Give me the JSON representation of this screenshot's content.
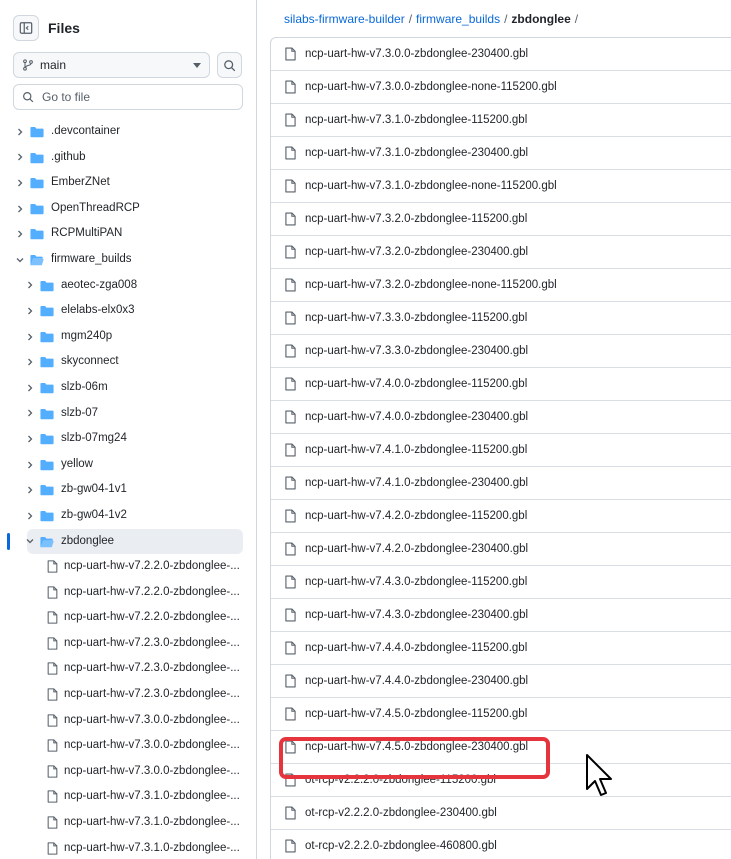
{
  "sidebar": {
    "title": "Files",
    "branch": "main",
    "goto_placeholder": "Go to file",
    "tree": [
      {
        "label": ".devcontainer",
        "type": "folder",
        "depth": 0,
        "expanded": false
      },
      {
        "label": ".github",
        "type": "folder",
        "depth": 0,
        "expanded": false
      },
      {
        "label": "EmberZNet",
        "type": "folder",
        "depth": 0,
        "expanded": false
      },
      {
        "label": "OpenThreadRCP",
        "type": "folder",
        "depth": 0,
        "expanded": false
      },
      {
        "label": "RCPMultiPAN",
        "type": "folder",
        "depth": 0,
        "expanded": false
      },
      {
        "label": "firmware_builds",
        "type": "folder",
        "depth": 0,
        "expanded": true
      },
      {
        "label": "aeotec-zga008",
        "type": "folder",
        "depth": 1,
        "expanded": false
      },
      {
        "label": "elelabs-elx0x3",
        "type": "folder",
        "depth": 1,
        "expanded": false
      },
      {
        "label": "mgm240p",
        "type": "folder",
        "depth": 1,
        "expanded": false
      },
      {
        "label": "skyconnect",
        "type": "folder",
        "depth": 1,
        "expanded": false
      },
      {
        "label": "slzb-06m",
        "type": "folder",
        "depth": 1,
        "expanded": false
      },
      {
        "label": "slzb-07",
        "type": "folder",
        "depth": 1,
        "expanded": false
      },
      {
        "label": "slzb-07mg24",
        "type": "folder",
        "depth": 1,
        "expanded": false
      },
      {
        "label": "yellow",
        "type": "folder",
        "depth": 1,
        "expanded": false
      },
      {
        "label": "zb-gw04-1v1",
        "type": "folder",
        "depth": 1,
        "expanded": false
      },
      {
        "label": "zb-gw04-1v2",
        "type": "folder",
        "depth": 1,
        "expanded": false
      },
      {
        "label": "zbdonglee",
        "type": "folder",
        "depth": 1,
        "expanded": true,
        "selected": true
      },
      {
        "label": "ncp-uart-hw-v7.2.2.0-zbdonglee-...",
        "type": "file",
        "depth": 2
      },
      {
        "label": "ncp-uart-hw-v7.2.2.0-zbdonglee-...",
        "type": "file",
        "depth": 2
      },
      {
        "label": "ncp-uart-hw-v7.2.2.0-zbdonglee-...",
        "type": "file",
        "depth": 2
      },
      {
        "label": "ncp-uart-hw-v7.2.3.0-zbdonglee-...",
        "type": "file",
        "depth": 2
      },
      {
        "label": "ncp-uart-hw-v7.2.3.0-zbdonglee-...",
        "type": "file",
        "depth": 2
      },
      {
        "label": "ncp-uart-hw-v7.2.3.0-zbdonglee-...",
        "type": "file",
        "depth": 2
      },
      {
        "label": "ncp-uart-hw-v7.3.0.0-zbdonglee-...",
        "type": "file",
        "depth": 2
      },
      {
        "label": "ncp-uart-hw-v7.3.0.0-zbdonglee-...",
        "type": "file",
        "depth": 2
      },
      {
        "label": "ncp-uart-hw-v7.3.0.0-zbdonglee-...",
        "type": "file",
        "depth": 2
      },
      {
        "label": "ncp-uart-hw-v7.3.1.0-zbdonglee-...",
        "type": "file",
        "depth": 2
      },
      {
        "label": "ncp-uart-hw-v7.3.1.0-zbdonglee-...",
        "type": "file",
        "depth": 2
      },
      {
        "label": "ncp-uart-hw-v7.3.1.0-zbdonglee-...",
        "type": "file",
        "depth": 2
      }
    ]
  },
  "breadcrumb": {
    "repo": "silabs-firmware-builder",
    "sep": "/",
    "folder": "firmware_builds",
    "current": "zbdonglee"
  },
  "files": [
    "ncp-uart-hw-v7.3.0.0-zbdonglee-230400.gbl",
    "ncp-uart-hw-v7.3.0.0-zbdonglee-none-115200.gbl",
    "ncp-uart-hw-v7.3.1.0-zbdonglee-115200.gbl",
    "ncp-uart-hw-v7.3.1.0-zbdonglee-230400.gbl",
    "ncp-uart-hw-v7.3.1.0-zbdonglee-none-115200.gbl",
    "ncp-uart-hw-v7.3.2.0-zbdonglee-115200.gbl",
    "ncp-uart-hw-v7.3.2.0-zbdonglee-230400.gbl",
    "ncp-uart-hw-v7.3.2.0-zbdonglee-none-115200.gbl",
    "ncp-uart-hw-v7.3.3.0-zbdonglee-115200.gbl",
    "ncp-uart-hw-v7.3.3.0-zbdonglee-230400.gbl",
    "ncp-uart-hw-v7.4.0.0-zbdonglee-115200.gbl",
    "ncp-uart-hw-v7.4.0.0-zbdonglee-230400.gbl",
    "ncp-uart-hw-v7.4.1.0-zbdonglee-115200.gbl",
    "ncp-uart-hw-v7.4.1.0-zbdonglee-230400.gbl",
    "ncp-uart-hw-v7.4.2.0-zbdonglee-115200.gbl",
    "ncp-uart-hw-v7.4.2.0-zbdonglee-230400.gbl",
    "ncp-uart-hw-v7.4.3.0-zbdonglee-115200.gbl",
    "ncp-uart-hw-v7.4.3.0-zbdonglee-230400.gbl",
    "ncp-uart-hw-v7.4.4.0-zbdonglee-115200.gbl",
    "ncp-uart-hw-v7.4.4.0-zbdonglee-230400.gbl",
    "ncp-uart-hw-v7.4.5.0-zbdonglee-115200.gbl",
    "ncp-uart-hw-v7.4.5.0-zbdonglee-230400.gbl",
    "ot-rcp-v2.2.2.0-zbdonglee-115200.gbl",
    "ot-rcp-v2.2.2.0-zbdonglee-230400.gbl",
    "ot-rcp-v2.2.2.0-zbdonglee-460800.gbl"
  ],
  "highlighted_file_index": 21,
  "colors": {
    "link": "#0969da",
    "folder": "#54aeff",
    "highlight": "#e5343b",
    "selected_bg": "#eaeef2"
  },
  "icons": {
    "sidebar_toggle": "sidebar-collapse-icon",
    "branch": "git-branch-icon",
    "search": "search-icon",
    "folder": "folder-icon",
    "folder_open": "folder-open-icon",
    "file": "file-icon",
    "chevron_right": "chevron-right-icon",
    "chevron_down": "chevron-down-icon"
  }
}
